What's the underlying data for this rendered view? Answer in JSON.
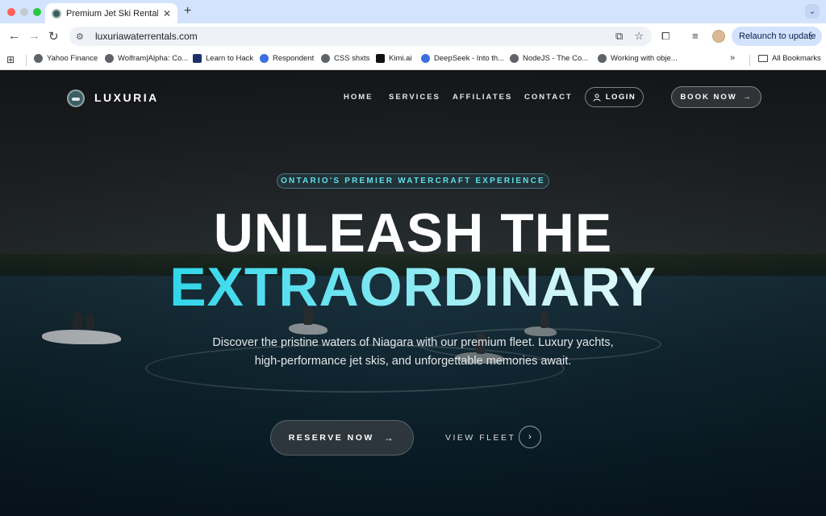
{
  "browser": {
    "tab_title": "Premium Jet Ski Rentals Niag",
    "url": "luxuriawaterrentals.com",
    "relaunch_label": "Relaunch to update",
    "bookmarks": [
      {
        "label": "Yahoo Finance"
      },
      {
        "label": "Wolfram|Alpha: Co..."
      },
      {
        "label": "Learn to Hack"
      },
      {
        "label": "Respondent"
      },
      {
        "label": "CSS shxts"
      },
      {
        "label": "Kimi.ai"
      },
      {
        "label": "DeepSeek - Into th..."
      },
      {
        "label": "NodeJS - The Co..."
      },
      {
        "label": "Working with obje..."
      }
    ],
    "all_bookmarks": "All Bookmarks"
  },
  "site": {
    "brand": "LUXURIA",
    "nav": [
      "HOME",
      "SERVICES",
      "AFFILIATES",
      "CONTACT"
    ],
    "login": "LOGIN",
    "book_now": "BOOK NOW"
  },
  "hero": {
    "eyebrow": "ONTARIO'S PREMIER WATERCRAFT EXPERIENCE",
    "line1": "UNLEASH THE",
    "line2": "EXTRAORDINARY",
    "subtitle": "Discover the pristine waters of Niagara with our premium fleet. Luxury yachts, high-performance jet skis, and unforgettable memories await.",
    "cta_primary": "RESERVE NOW",
    "cta_secondary": "VIEW FLEET"
  },
  "colors": {
    "accent": "#2fd6ea",
    "tabstrip": "#d3e3fd"
  },
  "icons": {
    "login": "user-icon",
    "book_now": "arrow-right-icon",
    "reserve": "arrow-right-icon",
    "fleet": "chevron-right-icon"
  }
}
